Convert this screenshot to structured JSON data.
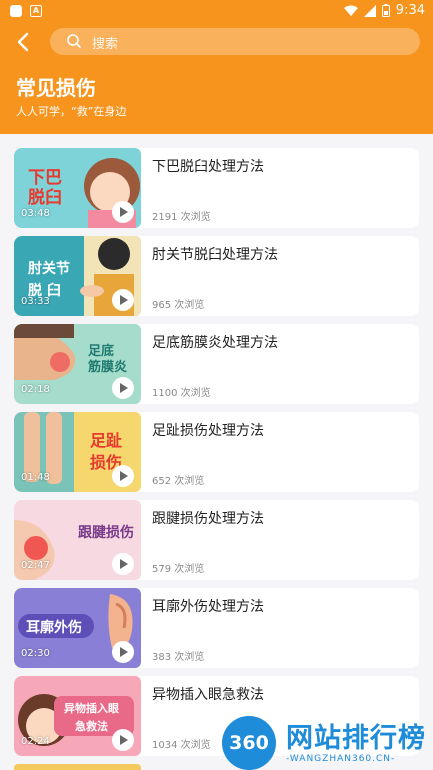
{
  "status_bar": {
    "time": "9:34"
  },
  "search": {
    "placeholder": "搜索"
  },
  "header": {
    "title": "常见损伤",
    "subtitle": "人人可学，“救”在身边"
  },
  "items": [
    {
      "title": "下巴脱臼处理方法",
      "views": "2191 次浏览",
      "duration": "03:48",
      "overlay": "下巴\n脱臼",
      "bg": "#7dd3d8"
    },
    {
      "title": "肘关节脱臼处理方法",
      "views": "965 次浏览",
      "duration": "03:33",
      "overlay": "肘关节\n脱 臼",
      "bg": "#3aa7b4"
    },
    {
      "title": "足底筋膜炎处理方法",
      "views": "1100 次浏览",
      "duration": "02:18",
      "overlay": "足底\n筋膜炎",
      "bg": "#a6dccc"
    },
    {
      "title": "足趾损伤处理方法",
      "views": "652 次浏览",
      "duration": "01:48",
      "overlay": "足趾\n损伤",
      "bg": "#f5d76e"
    },
    {
      "title": "跟腱损伤处理方法",
      "views": "579 次浏览",
      "duration": "02:47",
      "overlay": "跟腱损伤",
      "bg": "#f6d9e1"
    },
    {
      "title": "耳廓外伤处理方法",
      "views": "383 次浏览",
      "duration": "02:30",
      "overlay": "耳廓外伤",
      "bg": "#8a7fd6"
    },
    {
      "title": "异物插入眼急救法",
      "views": "1034 次浏览",
      "duration": "02:24",
      "overlay": "异物插入眼\n急救法",
      "bg": "#f7a8b8"
    }
  ],
  "watermark": {
    "badge": "360",
    "name": "网站排行榜",
    "url": "-WANGZHAN360.CN-"
  }
}
